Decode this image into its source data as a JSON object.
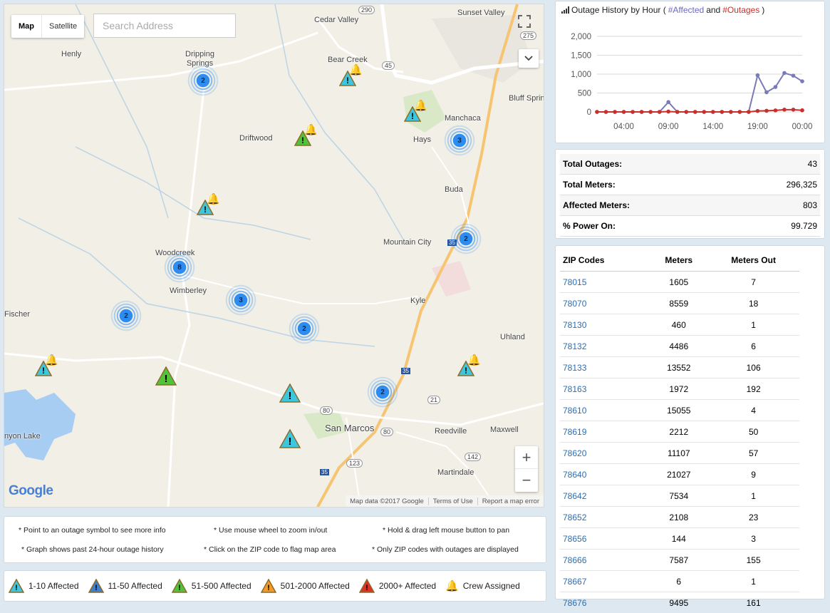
{
  "map": {
    "map_type": {
      "map": "Map",
      "satellite": "Satellite"
    },
    "search_placeholder": "Search Address",
    "places": [
      {
        "name": "Cedar Valley"
      },
      {
        "name": "Sunset Valley"
      },
      {
        "name": "Henly"
      },
      {
        "name": "Dripping\nSprings"
      },
      {
        "name": "Bear Creek"
      },
      {
        "name": "Bluff Sprin"
      },
      {
        "name": "Manchaca"
      },
      {
        "name": "Driftwood"
      },
      {
        "name": "Hays"
      },
      {
        "name": "Buda"
      },
      {
        "name": "Mountain City"
      },
      {
        "name": "Woodcreek"
      },
      {
        "name": "Wimberley"
      },
      {
        "name": "Kyle"
      },
      {
        "name": "Fischer"
      },
      {
        "name": "Uhland"
      },
      {
        "name": "San Marcos"
      },
      {
        "name": "Reedville"
      },
      {
        "name": "Maxwell"
      },
      {
        "name": "Martindale"
      },
      {
        "name": "nyon Lake"
      }
    ],
    "route_shields": [
      "290",
      "45",
      "275",
      "35",
      "35",
      "21",
      "80",
      "80",
      "123",
      "142",
      "35"
    ],
    "clusters": [
      {
        "count": "2"
      },
      {
        "count": "3"
      },
      {
        "count": "2"
      },
      {
        "count": "8"
      },
      {
        "count": "3"
      },
      {
        "count": "2"
      },
      {
        "count": "2"
      },
      {
        "count": "2"
      }
    ],
    "google_logo": "Google",
    "attribution": {
      "data": "Map data ©2017 Google",
      "terms": "Terms of Use",
      "report": "Report a map error"
    }
  },
  "chart": {
    "title_prefix": "Outage History by Hour (",
    "title_affected": "#Affected",
    "title_and": " and ",
    "title_outages": "#Outages",
    "title_suffix": ")",
    "colors": {
      "affected": "#7a7ab8",
      "outages": "#c9302c"
    },
    "chart_data": {
      "type": "line",
      "x": [
        "01:00",
        "02:00",
        "03:00",
        "04:00",
        "05:00",
        "06:00",
        "07:00",
        "08:00",
        "09:00",
        "10:00",
        "11:00",
        "12:00",
        "13:00",
        "14:00",
        "15:00",
        "16:00",
        "17:00",
        "18:00",
        "19:00",
        "20:00",
        "21:00",
        "22:00",
        "23:00",
        "00:00"
      ],
      "xticks": [
        "04:00",
        "09:00",
        "14:00",
        "19:00",
        "00:00"
      ],
      "yticks": [
        "0",
        "500",
        "1,000",
        "1,500",
        "2,000"
      ],
      "ylim": [
        0,
        2000
      ],
      "series": [
        {
          "name": "#Affected",
          "values": [
            0,
            0,
            0,
            0,
            0,
            0,
            0,
            0,
            260,
            0,
            0,
            0,
            0,
            0,
            0,
            0,
            0,
            0,
            970,
            520,
            660,
            1030,
            960,
            810
          ]
        },
        {
          "name": "#Outages",
          "values": [
            0,
            0,
            0,
            0,
            0,
            0,
            0,
            0,
            10,
            0,
            0,
            0,
            0,
            0,
            0,
            0,
            0,
            0,
            25,
            30,
            40,
            60,
            60,
            43
          ]
        }
      ],
      "grid": true
    }
  },
  "stats": [
    {
      "label": "Total Outages:",
      "value": "43"
    },
    {
      "label": "Total Meters:",
      "value": "296,325"
    },
    {
      "label": "Affected Meters:",
      "value": "803"
    },
    {
      "label": "% Power On:",
      "value": "99.729"
    }
  ],
  "zip_table": {
    "headers": [
      "ZIP Codes",
      "Meters",
      "Meters Out"
    ],
    "rows": [
      [
        "78015",
        "1605",
        "7"
      ],
      [
        "78070",
        "8559",
        "18"
      ],
      [
        "78130",
        "460",
        "1"
      ],
      [
        "78132",
        "4486",
        "6"
      ],
      [
        "78133",
        "13552",
        "106"
      ],
      [
        "78163",
        "1972",
        "192"
      ],
      [
        "78610",
        "15055",
        "4"
      ],
      [
        "78619",
        "2212",
        "50"
      ],
      [
        "78620",
        "11107",
        "57"
      ],
      [
        "78640",
        "21027",
        "9"
      ],
      [
        "78642",
        "7534",
        "1"
      ],
      [
        "78652",
        "2108",
        "23"
      ],
      [
        "78656",
        "144",
        "3"
      ],
      [
        "78666",
        "7587",
        "155"
      ],
      [
        "78667",
        "6",
        "1"
      ],
      [
        "78676",
        "9495",
        "161"
      ]
    ]
  },
  "tips": [
    "* Point to an outage symbol to see more info",
    "* Use mouse wheel to zoom in/out",
    "* Hold & drag left mouse button to pan",
    "* Graph shows past 24-hour outage history",
    "* Click on the ZIP code to flag map area",
    "* Only ZIP codes with outages are displayed"
  ],
  "legend": [
    {
      "label": "1-10 Affected",
      "color": "#3cc6e0"
    },
    {
      "label": "11-50 Affected",
      "color": "#3f7fd0"
    },
    {
      "label": "51-500 Affected",
      "color": "#52c23a"
    },
    {
      "label": "501-2000 Affected",
      "color": "#f39a2a"
    },
    {
      "label": "2000+ Affected",
      "color": "#e0302a"
    },
    {
      "label": "Crew Assigned",
      "color": "#f5d21b"
    }
  ]
}
